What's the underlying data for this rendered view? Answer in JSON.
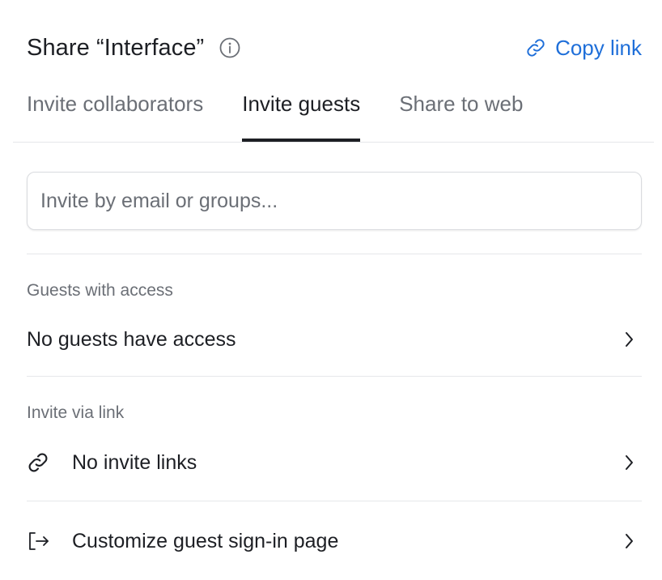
{
  "header": {
    "title": "Share “Interface”",
    "copy_link_label": "Copy link",
    "accent_color": "#1f6fd9"
  },
  "tabs": [
    {
      "label": "Invite collaborators",
      "active": false
    },
    {
      "label": "Invite guests",
      "active": true
    },
    {
      "label": "Share to web",
      "active": false
    }
  ],
  "invite": {
    "placeholder": "Invite by email or groups...",
    "value": ""
  },
  "guests_section": {
    "label": "Guests with access",
    "row_label": "No guests have access"
  },
  "link_section": {
    "label": "Invite via link",
    "row_label": "No invite links",
    "row_icon": "link-icon"
  },
  "signin_row": {
    "label": "Customize guest sign-in page",
    "icon": "sign-in-icon"
  }
}
